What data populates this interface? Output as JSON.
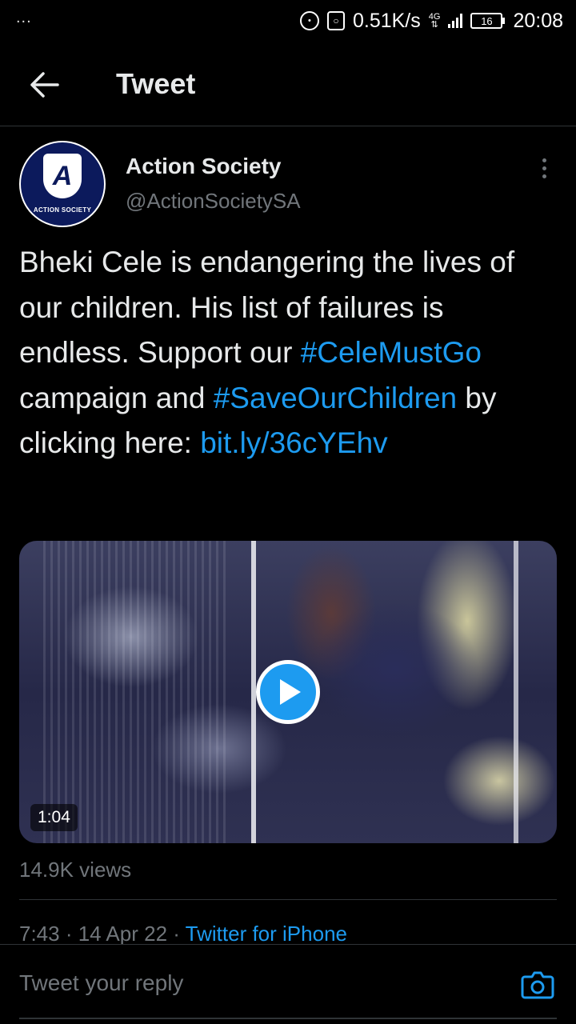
{
  "status_bar": {
    "left_dots": "...",
    "speed": "0.51K/s",
    "network": "4G",
    "battery": "16",
    "time": "20:08"
  },
  "header": {
    "title": "Tweet"
  },
  "author": {
    "name": "Action Society",
    "handle": "@ActionSocietySA",
    "avatar_letter": "A",
    "avatar_caption": "ACTION SOCIETY"
  },
  "tweet": {
    "text_part1": "Bheki Cele is endangering the lives of our children. His list of failures is endless. Support our ",
    "hashtag1": "#CeleMustGo",
    "text_part2": " campaign and ",
    "hashtag2": "#SaveOurChildren",
    "text_part3": " by clicking here: ",
    "link": "bit.ly/36cYEhv"
  },
  "video": {
    "duration": "1:04"
  },
  "stats": {
    "views": "14.9K views"
  },
  "meta": {
    "time": "7:43",
    "date": "14 Apr 22",
    "separator": " · ",
    "source": "Twitter for iPhone"
  },
  "reply": {
    "placeholder": "Tweet your reply"
  },
  "colors": {
    "accent": "#1d9bf0",
    "background": "#000000",
    "secondary_text": "#71767b"
  }
}
